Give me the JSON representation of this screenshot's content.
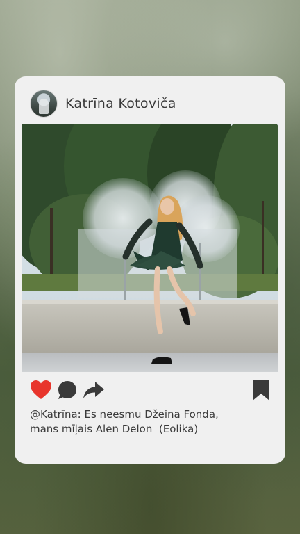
{
  "post": {
    "username": "Katrīna Kotoviča",
    "caption_line1": "@Katrīna: Es neesmu Džeina Fonda,",
    "caption_line2": "mans mīļais Alen Delon  (Eolika)"
  },
  "icons": {
    "like": "heart-icon",
    "comment": "comment-bubble-icon",
    "share": "share-arrow-icon",
    "save": "bookmark-icon"
  },
  "colors": {
    "card_background": "#f0f0f0",
    "like": "#e8352c",
    "icons": "#3a3a3a",
    "text": "#3a3a3a"
  }
}
